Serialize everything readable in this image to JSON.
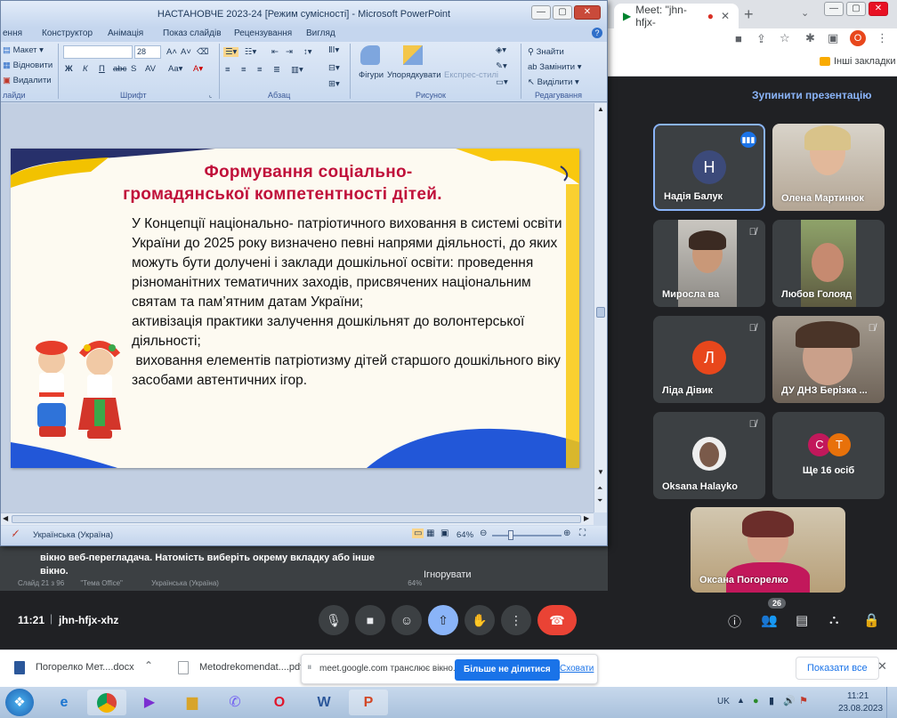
{
  "chrome": {
    "tab_title": "Meet: \"jhn-hfjx-",
    "bookmark_folder": "Інші закладки",
    "profile_initial": "О"
  },
  "ppt": {
    "title": "НАСТАНОВЧЕ 2023-24 [Режим сумісності] - Microsoft PowerPoint",
    "tabs": [
      "ення",
      "Конструктор",
      "Анімація",
      "Показ слайдів",
      "Рецензування",
      "Вигляд"
    ],
    "ribbon": {
      "layout": "Макет",
      "restore": "Відновити",
      "delete": "Видалити",
      "slides_group": "лайди",
      "font_size": "28",
      "font_group": "Шрифт",
      "paragraph_group": "Абзац",
      "shapes": "Фігури",
      "arrange": "Упорядкувати",
      "quick_styles": "Експрес-стилі",
      "drawing_group": "Рисунок",
      "find": "Знайти",
      "replace": "Замінити",
      "select": "Виділити",
      "editing_group": "Редагування"
    },
    "slide": {
      "title_line1": "Формування  соціально-",
      "title_line2": "громадянської компетентності  дітей.",
      "para1": "У Концепції національно- патріотичного виховання в системі освіти України до 2025 року визначено певні напрями діяльності, до яких можуть бути долучені і заклади дошкільної освіти: проведення різноманітних тематичних заходів, присвячених національним святам та пам’ятним датам України;",
      "para2": "активізація практики залучення дошкільнят до волонтерської діяльності;",
      "para3": " виховання елементів патріотизму дітей старшого дошкільного віку засобами автентичних ігор."
    },
    "status": {
      "language": "Українська (Україна)",
      "zoom": "64%"
    }
  },
  "meet": {
    "stop_presenting": "Зупинити презентацію",
    "participants": [
      {
        "name": "Надія Балук",
        "initial": "Н",
        "avatar_color": "#3c4a7a",
        "speaking": true
      },
      {
        "name": "Олена Мартинюк",
        "video": true
      },
      {
        "name": "Миросла ва",
        "video": true,
        "muted": true
      },
      {
        "name": "Любов Голояд",
        "video": true
      },
      {
        "name": "Ліда Дівик",
        "initial": "Л",
        "avatar_color": "#e8471c",
        "muted": true
      },
      {
        "name": "ДУ ДНЗ Берізка ...",
        "video": true,
        "muted": true
      },
      {
        "name": "Oksana Halayko",
        "video": true,
        "muted": true
      },
      {
        "name": "Ще 16 осіб",
        "initials": [
          "С",
          "Т"
        ]
      },
      {
        "name": "Оксана Погорелко",
        "video": true
      }
    ],
    "meeting_time": "11:21",
    "meeting_code": "jhn-hfjx-xhz",
    "participant_count": "26",
    "notice_line1": "вікно веб-перегладача. Натомість виберіть окрему вкладку або інше",
    "notice_line2": "вікно.",
    "ignore": "Ігнорувати",
    "bg_slide_info": "Слайд 21 з 96",
    "bg_theme": "\"Тема Office\"",
    "bg_language": "Українська (Україна)",
    "bg_zoom": "64%"
  },
  "downloads": {
    "file1": "Погорелко Мет....docx",
    "file2": "Metodrekomendat....pdf",
    "share_text": "meet.google.com транслює вікно.",
    "stop_sharing": "Більше не ділитися",
    "hide": "Сховати",
    "show_all": "Показати все"
  },
  "taskbar": {
    "lang": "UK",
    "time": "11:21",
    "date": "23.08.2023"
  }
}
